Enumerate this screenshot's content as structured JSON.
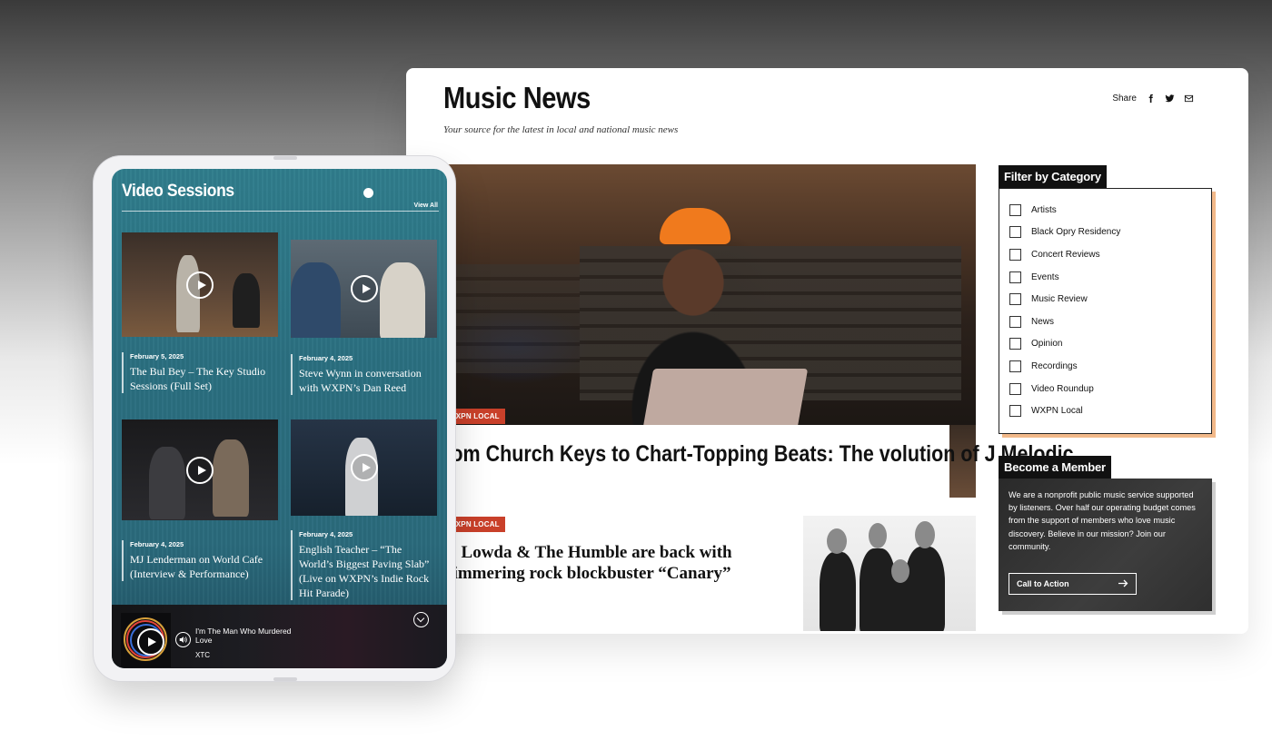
{
  "desktop": {
    "title": "Music News",
    "subtitle": "Your source for the latest in local and national music news",
    "share": {
      "label": "Share",
      "icons": [
        "facebook-icon",
        "twitter-icon",
        "email-icon"
      ]
    },
    "hero": {
      "tag": "WXPN LOCAL",
      "headline": "rom Church Keys to Chart-Topping Beats: The volution of J Melodic"
    },
    "second_story": {
      "tag": "WXPN LOCAL",
      "headline": "lo Lowda & The Humble are back with himmering rock blockbuster “Canary”"
    },
    "filter": {
      "heading": "Filter by Category",
      "items": [
        "Artists",
        "Black Opry Residency",
        "Concert Reviews",
        "Events",
        "Music Review",
        "News",
        "Opinion",
        "Recordings",
        "Video Roundup",
        "WXPN Local"
      ]
    },
    "member": {
      "heading": "Become a Member",
      "text": "We are a nonprofit public music service supported by listeners. Over half our operating budget comes from the support of members who love music discovery. Believe in our mission? Join our community.",
      "cta_label": "Call to Action"
    },
    "colors": {
      "tag_red": "#c9402a",
      "accent_orange": "#f2b98a",
      "teal": "#2a6f80"
    }
  },
  "tablet": {
    "section_title": "Video Sessions",
    "view_all": "View All",
    "videos": [
      {
        "date": "February 5, 2025",
        "title": "The Bul Bey – The Key Studio Sessions (Full Set)"
      },
      {
        "date": "February 4, 2025",
        "title": "Steve Wynn in conversation with WXPN’s Dan Reed"
      },
      {
        "date": "February 4, 2025",
        "title": "MJ Lenderman on World Cafe (Interview & Performance)"
      },
      {
        "date": "February 4, 2025",
        "title": "English Teacher – “The World’s Biggest Paving Slab” (Live on WXPN’s Indie Rock Hit Parade)"
      }
    ],
    "player": {
      "track": "I'm The Man Who Murdered Love",
      "artist": "XTC"
    }
  }
}
